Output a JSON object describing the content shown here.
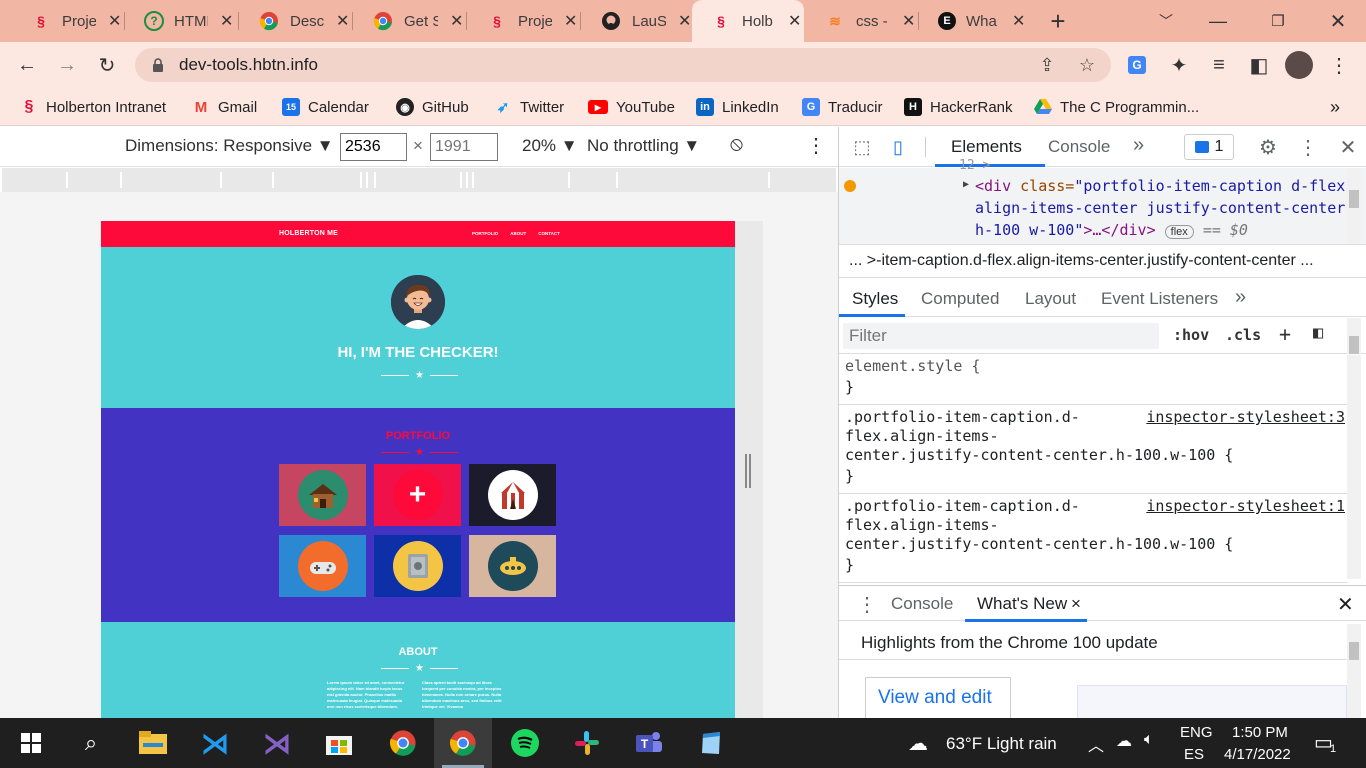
{
  "browser": {
    "tabs": [
      {
        "title": "Proje",
        "icon": "holberton-icon",
        "color": "#e0103a"
      },
      {
        "title": "HTML",
        "icon": "question-icon",
        "color": "#1e8e3e"
      },
      {
        "title": "Desc",
        "icon": "chrome-icon",
        "color": "#4285f4"
      },
      {
        "title": "Get S",
        "icon": "chrome-icon",
        "color": "#4285f4"
      },
      {
        "title": "Proje",
        "icon": "holberton-icon",
        "color": "#e0103a"
      },
      {
        "title": "LauS",
        "icon": "github-icon",
        "color": "#222222"
      },
      {
        "title": "Holb",
        "icon": "holberton-icon",
        "color": "#e0103a"
      },
      {
        "title": "css -",
        "icon": "stackoverflow-icon",
        "color": "#f48024"
      },
      {
        "title": "Wha",
        "icon": "e-icon",
        "color": "#111111"
      }
    ],
    "url": "dev-tools.hbtn.info",
    "bookmarks": [
      {
        "label": "Holberton Intranet",
        "icon": "holberton-icon",
        "color": "#e0103a"
      },
      {
        "label": "Gmail",
        "icon": "gmail-icon",
        "color": "#ea4335"
      },
      {
        "label": "Calendar",
        "icon": "calendar-icon",
        "color": "#1a73e8"
      },
      {
        "label": "GitHub",
        "icon": "github-icon",
        "color": "#222222"
      },
      {
        "label": "Twitter",
        "icon": "twitter-icon",
        "color": "#1d9bf0"
      },
      {
        "label": "YouTube",
        "icon": "youtube-icon",
        "color": "#ff0000"
      },
      {
        "label": "LinkedIn",
        "icon": "linkedin-icon",
        "color": "#0a66c2"
      },
      {
        "label": "Traducir",
        "icon": "translate-icon",
        "color": "#4285f4"
      },
      {
        "label": "HackerRank",
        "icon": "hackerrank-icon",
        "color": "#111111"
      },
      {
        "label": "The C Programmin...",
        "icon": "drive-icon",
        "color": "#fbbc04"
      }
    ],
    "calendar_day": "15",
    "more_bookmarks": "»"
  },
  "device_toolbar": {
    "dimensions_label": "Dimensions: Responsive ▼",
    "width": "2536",
    "times": "×",
    "height_placeholder": "1991",
    "zoom": "20% ▼",
    "throttling": "No throttling ▼"
  },
  "site": {
    "brand": "HOLBERTON ME",
    "nav": [
      "PORTFOLIO",
      "ABOUT",
      "CONTACT"
    ],
    "hero_title": "HI, I'M THE CHECKER!",
    "portfolio_title": "PORTFOLIO",
    "tiles": [
      {
        "icon": "cabin-icon",
        "bg": "#c64560",
        "circle": "#2c8c6e"
      },
      {
        "icon": "plus-icon",
        "bg": "#f0104a",
        "circle": "#fe0a3a"
      },
      {
        "icon": "circus-tent-icon",
        "bg": "#1b1b2b",
        "circle": "#ffffff"
      },
      {
        "icon": "game-controller-icon",
        "bg": "#2b88d2",
        "circle": "#f26c2b"
      },
      {
        "icon": "safe-icon",
        "bg": "#0d2fa8",
        "circle": "#f4c545"
      },
      {
        "icon": "submarine-icon",
        "bg": "#d7b69f",
        "circle": "#1f4a5a"
      }
    ],
    "about_title": "ABOUT",
    "about_left": "Lorem ipsum dolor sit amet, consectetur adipiscing elit. Nam blandit turpis lacus nisl gravida auctor. Phasellus mattis malesuada feugiat. Quisque malesuada orci non risus scelerisque bibendum.",
    "about_right": "Class aptent taciti sociosqu ad litora torquent per conubia nostra, per inceptos himenaeos. Nulla non ornare purus. Nulla bibendum maximus arcu, sed finibus velit tristique vel. Vivamus"
  },
  "devtools": {
    "tabs": [
      "Elements",
      "Console"
    ],
    "more_tabs": "»",
    "issues_count": "1",
    "node_open": "<div ",
    "attr_name": "class=",
    "attr_value_1": "\"portfolio-item-caption d-flex",
    "attr_value_2": "align-items-center justify-content-center",
    "attr_value_3": "h-100 w-100\"",
    "node_close": ">…</div>",
    "flex_badge": "flex",
    "eq_dollar": "== $0",
    "partial_top": "12 >",
    "breadcrumb": "...  >-item-caption.d-flex.align-items-center.justify-content-center  ...",
    "style_tabs": [
      "Styles",
      "Computed",
      "Layout",
      "Event Listeners"
    ],
    "style_more": "»",
    "filter_placeholder": "Filter",
    "hov": ":hov",
    ".cls": ".cls",
    "plus": "+",
    "rules": [
      {
        "selector": "element.style {",
        "close": "}",
        "source": ""
      },
      {
        "selector": ".portfolio-item-caption.d-\nflex.align-items-\ncenter.justify-content-center.h-100.w-100 {",
        "close": "}",
        "source": "inspector-stylesheet:3"
      },
      {
        "selector": ".portfolio-item-caption.d-\nflex.align-items-\ncenter.justify-content-center.h-100.w-100 {",
        "close": "}",
        "source": "inspector-stylesheet:1"
      }
    ],
    "drawer_tabs": [
      "Console",
      "What's New"
    ],
    "drawer_close_tab": "×",
    "whats_new_heading": "Highlights from the Chrome 100 update",
    "view_and_edit": "View and edit"
  },
  "taskbar": {
    "weather": "63°F  Light rain",
    "lang_1": "ENG",
    "lang_2": "ES",
    "time": "1:50 PM",
    "date": "4/17/2022",
    "notifications": "1"
  }
}
